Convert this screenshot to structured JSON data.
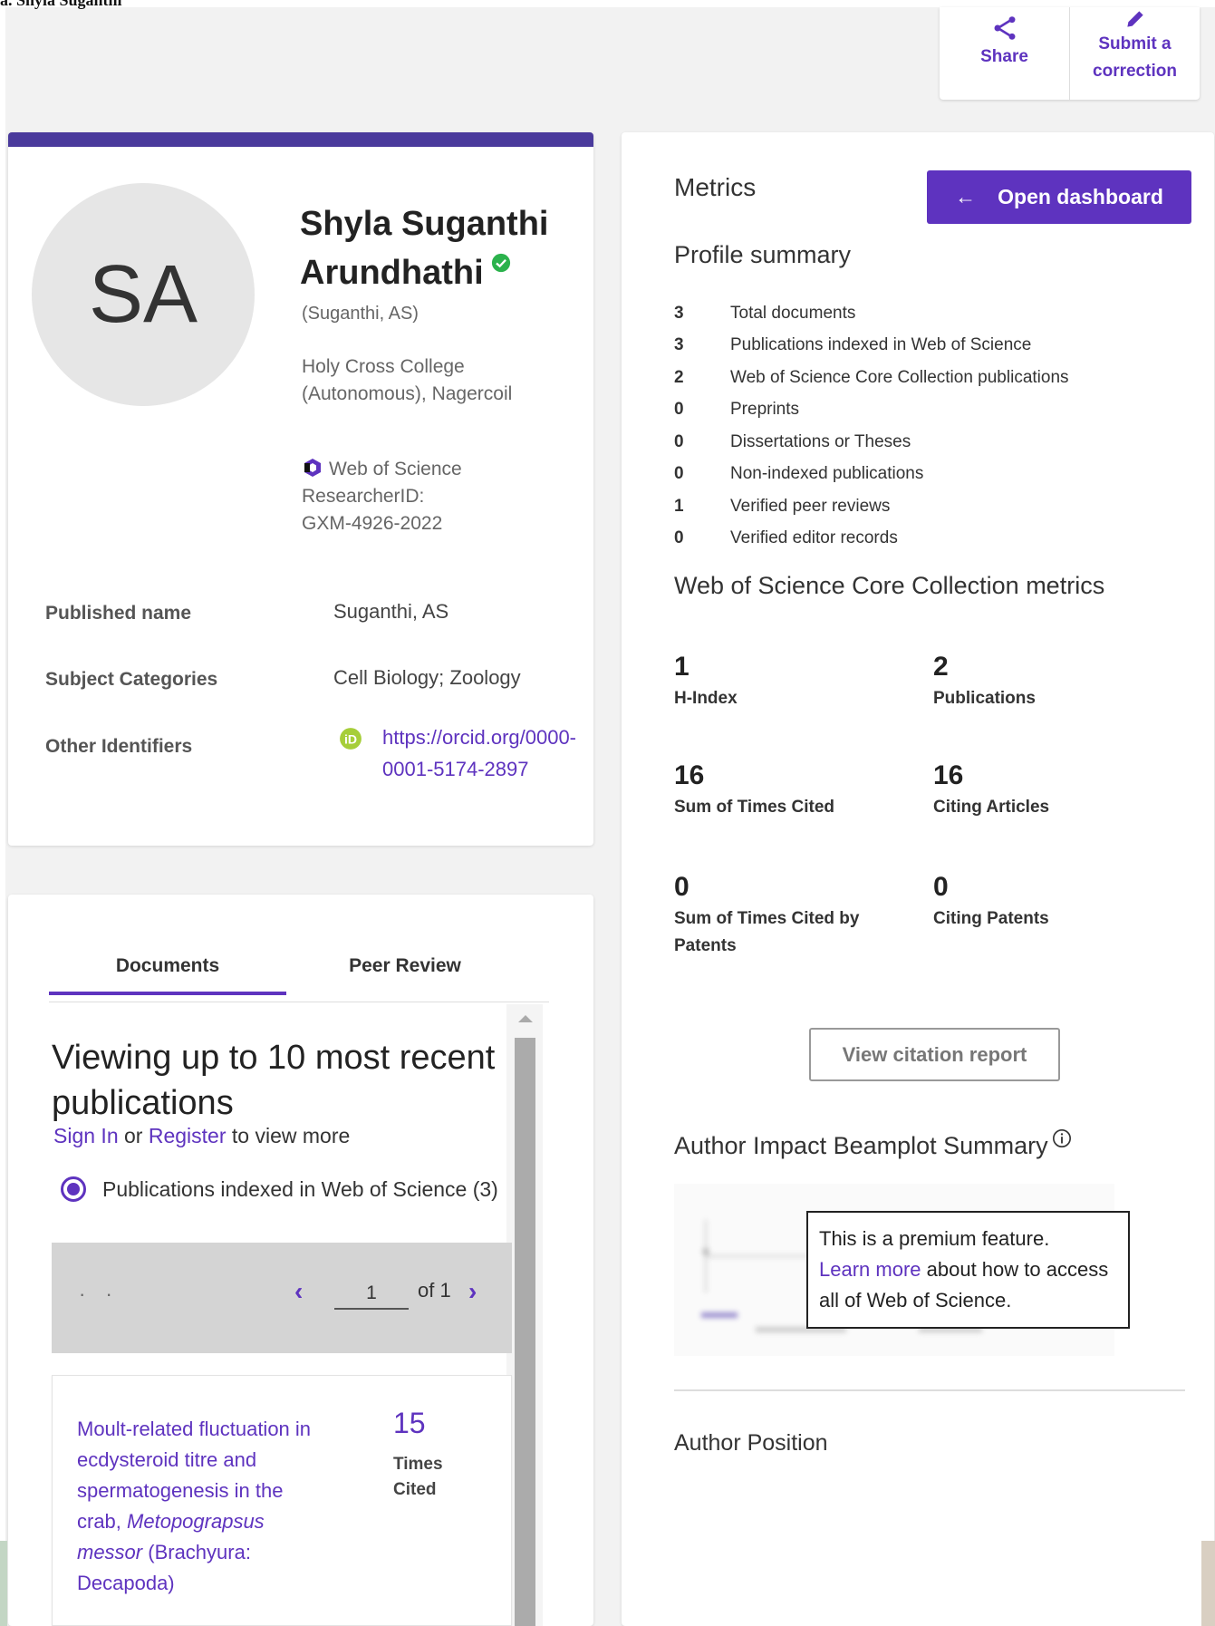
{
  "top_strip": {
    "text": "a. Shyla Suganthi"
  },
  "actions": {
    "share": "Share",
    "submit": "Submit a correction"
  },
  "profile": {
    "initials": "SA",
    "name": "Shyla Suganthi Arundhathi",
    "alt_name": "(Suganthi, AS)",
    "affiliation": "Holy Cross College (Autonomous), Nagercoil",
    "researcher_id_label": "Web of Science ResearcherID:",
    "researcher_id": "GXM-4926-2022",
    "fields": {
      "published_name_label": "Published name",
      "published_name": "Suganthi, AS",
      "subject_label": "Subject Categories",
      "subjects": "Cell Biology;  Zoology",
      "other_label": "Other Identifiers",
      "orcid_line1": "https://orcid.org/0000-",
      "orcid_line2": "0001-5174-2897"
    }
  },
  "metrics": {
    "title": "Metrics",
    "dashboard_button": "Open dashboard",
    "summary_title": "Profile summary",
    "summary": [
      {
        "value": "3",
        "label": "Total documents"
      },
      {
        "value": "3",
        "label": "Publications indexed in Web of Science"
      },
      {
        "value": "2",
        "label": "Web of Science Core Collection publications"
      },
      {
        "value": "0",
        "label": "Preprints"
      },
      {
        "value": "0",
        "label": "Dissertations or Theses"
      },
      {
        "value": "0",
        "label": "Non-indexed publications"
      },
      {
        "value": "1",
        "label": "Verified peer reviews"
      },
      {
        "value": "0",
        "label": "Verified editor records"
      }
    ],
    "core_title": "Web of Science Core Collection metrics",
    "stats": [
      {
        "value": "1",
        "label": "H-Index"
      },
      {
        "value": "2",
        "label": "Publications"
      },
      {
        "value": "16",
        "label": "Sum of Times Cited"
      },
      {
        "value": "16",
        "label": "Citing Articles"
      },
      {
        "value": "0",
        "label": "Sum of Times Cited by Patents"
      },
      {
        "value": "0",
        "label": "Citing Patents"
      }
    ],
    "citation_button": "View citation report",
    "beamplot_title": "Author Impact Beamplot Summary",
    "premium_text_1": "This is a premium feature.",
    "premium_link": "Learn more",
    "premium_text_2": " about how to access all of Web of Science.",
    "author_position": "Author Position"
  },
  "documents": {
    "tab_documents": "Documents",
    "tab_peer_review": "Peer Review",
    "viewing_title": "Viewing up to 10 most recent publications",
    "sign_in": "Sign In",
    "or": " or ",
    "register": "Register",
    "to_view_more": " to view more",
    "radio_label": "Publications indexed in Web of Science (3)",
    "pager": {
      "current": "1",
      "of": "of 1"
    },
    "items": [
      {
        "title_part1": "Moult-related fluctuation in ecdysteroid titre and spermatogenesis in the crab, ",
        "title_italic": "Metopograpsus messor",
        "title_part2": " (Brachyura: Decapoda)",
        "times_cited": "15",
        "times_cited_label": "Times Cited"
      }
    ]
  },
  "colors": {
    "accent": "#5e33bf",
    "header_band": "#4a3a9c",
    "verified": "#2bb24c"
  }
}
